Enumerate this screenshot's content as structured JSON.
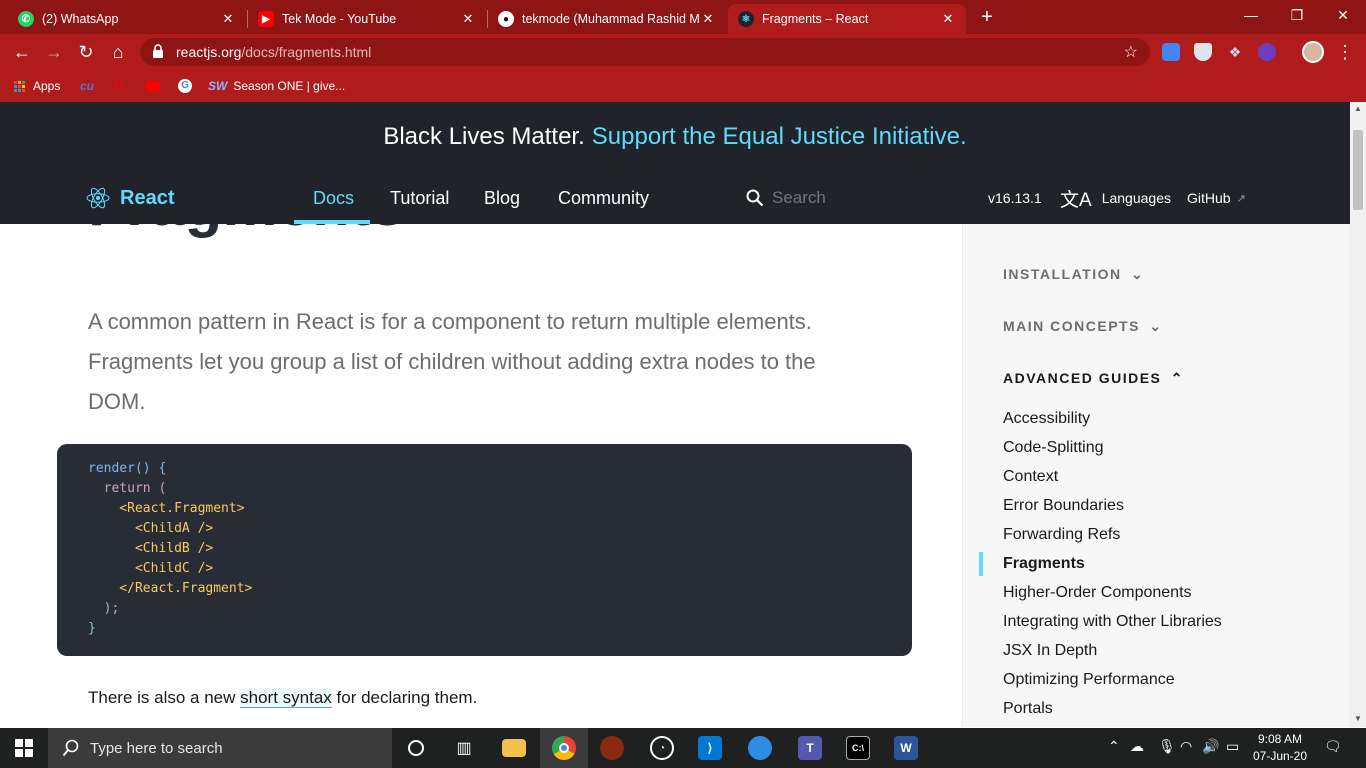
{
  "browser": {
    "tabs": [
      {
        "title": "(2) WhatsApp",
        "icon": "whatsapp-icon"
      },
      {
        "title": "Tek Mode - YouTube",
        "icon": "youtube-icon"
      },
      {
        "title": "tekmode (Muhammad Rashid Mu",
        "icon": "github-icon"
      },
      {
        "title": "Fragments – React",
        "icon": "react-icon",
        "active": true
      }
    ],
    "new_tab": "+",
    "url_host": "reactjs.org",
    "url_path": "/docs/fragments.html",
    "bookmarks": {
      "apps": "Apps",
      "season": "Season ONE | give..."
    },
    "window_controls": {
      "minimize": "—",
      "restore": "❐",
      "close": "✕"
    }
  },
  "banner": {
    "text": "Black Lives Matter.",
    "link": "Support the Equal Justice Initiative."
  },
  "nav": {
    "logo": "React",
    "links": [
      "Docs",
      "Tutorial",
      "Blog",
      "Community"
    ],
    "search_placeholder": "Search",
    "version": "v16.13.1",
    "languages": "Languages",
    "github": "GitHub"
  },
  "article": {
    "title": "Fragments",
    "intro": "A common pattern in React is for a component to return multiple elements. Fragments let you group a list of children without adding extra nodes to the DOM.",
    "code_lines": [
      "render() {",
      "  return (",
      "    <React.Fragment>",
      "      <ChildA />",
      "      <ChildB />",
      "      <ChildC />",
      "    </React.Fragment>",
      "  );",
      "}"
    ],
    "outro_before": "There is also a new ",
    "outro_link": "short syntax",
    "outro_after": " for declaring them."
  },
  "sidebar": {
    "sections": [
      {
        "label": "INSTALLATION",
        "chevron": "⌄"
      },
      {
        "label": "MAIN CONCEPTS",
        "chevron": "⌄"
      },
      {
        "label": "ADVANCED GUIDES",
        "chevron": "⌃"
      }
    ],
    "items": [
      "Accessibility",
      "Code-Splitting",
      "Context",
      "Error Boundaries",
      "Forwarding Refs",
      "Fragments",
      "Higher-Order Components",
      "Integrating with Other Libraries",
      "JSX In Depth",
      "Optimizing Performance",
      "Portals"
    ],
    "current": "Fragments"
  },
  "taskbar": {
    "search_placeholder": "Type here to search",
    "time": "9:08 AM",
    "date": "07-Jun-20"
  },
  "colors": {
    "accent": "#61dafb",
    "dark": "#20232a",
    "chrome": "#b01c1c"
  }
}
